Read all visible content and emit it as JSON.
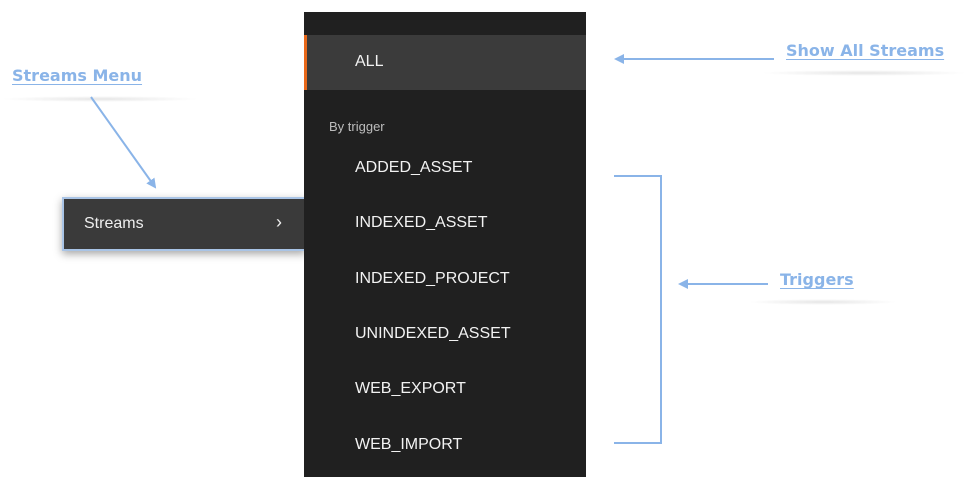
{
  "callouts": {
    "streams_menu": "Streams Menu",
    "show_all": "Show All Streams",
    "triggers": "Triggers"
  },
  "menu_item": {
    "label": "Streams",
    "chevron": "›"
  },
  "submenu": {
    "all_label": "ALL",
    "section_label": "By trigger",
    "triggers": [
      "ADDED_ASSET",
      "INDEXED_ASSET",
      "INDEXED_PROJECT",
      "UNINDEXED_ASSET",
      "WEB_EXPORT",
      "WEB_IMPORT"
    ]
  },
  "colors": {
    "annotation": "#8ab4e8",
    "menu_bg": "#202020",
    "selected_bg": "#3b3b3b",
    "accent": "#e8681a"
  }
}
